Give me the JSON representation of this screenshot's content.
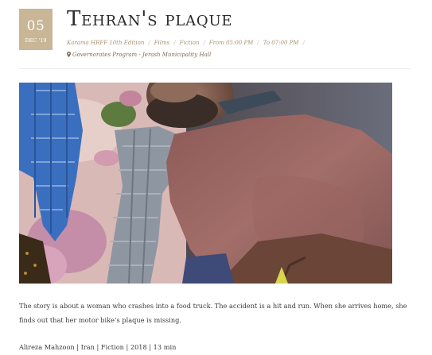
{
  "event": {
    "date": {
      "day": "05",
      "month_year": "DEC '19"
    },
    "title": "Tehran's plaque",
    "meta": {
      "edition": "Karama HRFF 10th Edition",
      "category": "Films",
      "genre": "Fiction",
      "start": "From 05:00 PM",
      "end": "To 07:00 PM"
    },
    "location": "Governorates Program - Jerash Municipality Hall",
    "image_icon": "film-still-image",
    "pin_icon": "map-marker-icon",
    "description": "The story is about a woman who crashes into a food truck. The accident is a hit and run. When she arrives home, she finds out that her motor bike’s plaque is missing.",
    "credits": "Alireza Mahzoon | Iran | Fiction | 2018 | 13 min"
  },
  "colors": {
    "badge": "#c8b697",
    "meta_text": "#a89272",
    "body_text": "#3a3a3a"
  }
}
